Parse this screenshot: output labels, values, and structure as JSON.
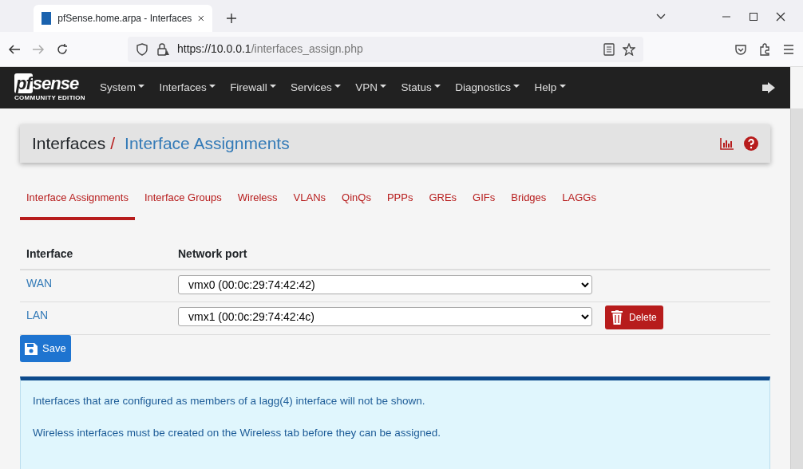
{
  "browser": {
    "tab_title": "pfSense.home.arpa - Interfaces",
    "url_host": "https://10.0.0.1",
    "url_path": "/interfaces_assign.php"
  },
  "navbar": {
    "logo": "sense",
    "logo_prefix": "pf",
    "logo_sub": "COMMUNITY EDITION",
    "menus": [
      "System",
      "Interfaces",
      "Firewall",
      "Services",
      "VPN",
      "Status",
      "Diagnostics",
      "Help"
    ]
  },
  "breadcrumb": {
    "parent": "Interfaces",
    "separator": "/",
    "current": "Interface Assignments"
  },
  "tabs": [
    {
      "label": "Interface Assignments",
      "selected": true
    },
    {
      "label": "Interface Groups",
      "selected": false
    },
    {
      "label": "Wireless",
      "selected": false
    },
    {
      "label": "VLANs",
      "selected": false
    },
    {
      "label": "QinQs",
      "selected": false
    },
    {
      "label": "PPPs",
      "selected": false
    },
    {
      "label": "GREs",
      "selected": false
    },
    {
      "label": "GIFs",
      "selected": false
    },
    {
      "label": "Bridges",
      "selected": false
    },
    {
      "label": "LAGGs",
      "selected": false
    }
  ],
  "table": {
    "columns": [
      "Interface",
      "Network port"
    ],
    "rows": [
      {
        "interface": "WAN",
        "port": "vmx0 (00:0c:29:74:42:42)",
        "deletable": false
      },
      {
        "interface": "LAN",
        "port": "vmx1 (00:0c:29:74:42:4c)",
        "deletable": true,
        "delete_label": "Delete"
      }
    ]
  },
  "save_button": "Save",
  "info": [
    "Interfaces that are configured as members of a lagg(4) interface will not be shown.",
    "Wireless interfaces must be created on the Wireless tab before they can be assigned."
  ]
}
